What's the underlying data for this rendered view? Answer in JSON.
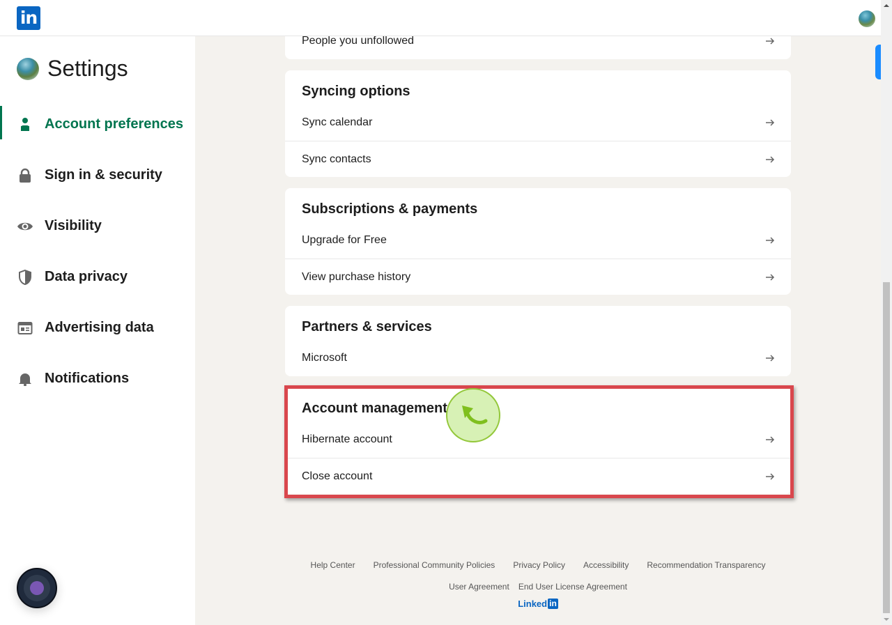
{
  "topbar": {
    "logo_text": "in",
    "logo_color": "#0a66c2"
  },
  "sidebar": {
    "title": "Settings",
    "active_color": "#01754f",
    "items": [
      {
        "label": "Account preferences",
        "icon": "person-icon",
        "active": true
      },
      {
        "label": "Sign in & security",
        "icon": "lock-icon",
        "active": false
      },
      {
        "label": "Visibility",
        "icon": "eye-icon",
        "active": false
      },
      {
        "label": "Data privacy",
        "icon": "shield-icon",
        "active": false
      },
      {
        "label": "Advertising data",
        "icon": "ad-icon",
        "active": false
      },
      {
        "label": "Notifications",
        "icon": "bell-icon",
        "active": false
      }
    ]
  },
  "main": {
    "partial_card": {
      "rows": [
        {
          "label": "People you unfollowed"
        }
      ]
    },
    "cards": [
      {
        "title": "Syncing options",
        "rows": [
          {
            "label": "Sync calendar"
          },
          {
            "label": "Sync contacts"
          }
        ]
      },
      {
        "title": "Subscriptions & payments",
        "rows": [
          {
            "label": "Upgrade for Free"
          },
          {
            "label": "View purchase history"
          }
        ]
      },
      {
        "title": "Partners & services",
        "rows": [
          {
            "label": "Microsoft"
          }
        ]
      },
      {
        "title": "Account management",
        "highlighted": true,
        "rows": [
          {
            "label": "Hibernate account"
          },
          {
            "label": "Close account"
          }
        ]
      }
    ]
  },
  "annotation": {
    "highlight_color": "#d9474d",
    "cursor_marker_color": "#93c73a"
  },
  "footer": {
    "links_row1": [
      "Help Center",
      "Professional Community Policies",
      "Privacy Policy",
      "Accessibility",
      "Recommendation Transparency"
    ],
    "links_row2": [
      "User Agreement",
      "End User License Agreement"
    ],
    "brand_text": "Linked",
    "brand_box": "in"
  }
}
